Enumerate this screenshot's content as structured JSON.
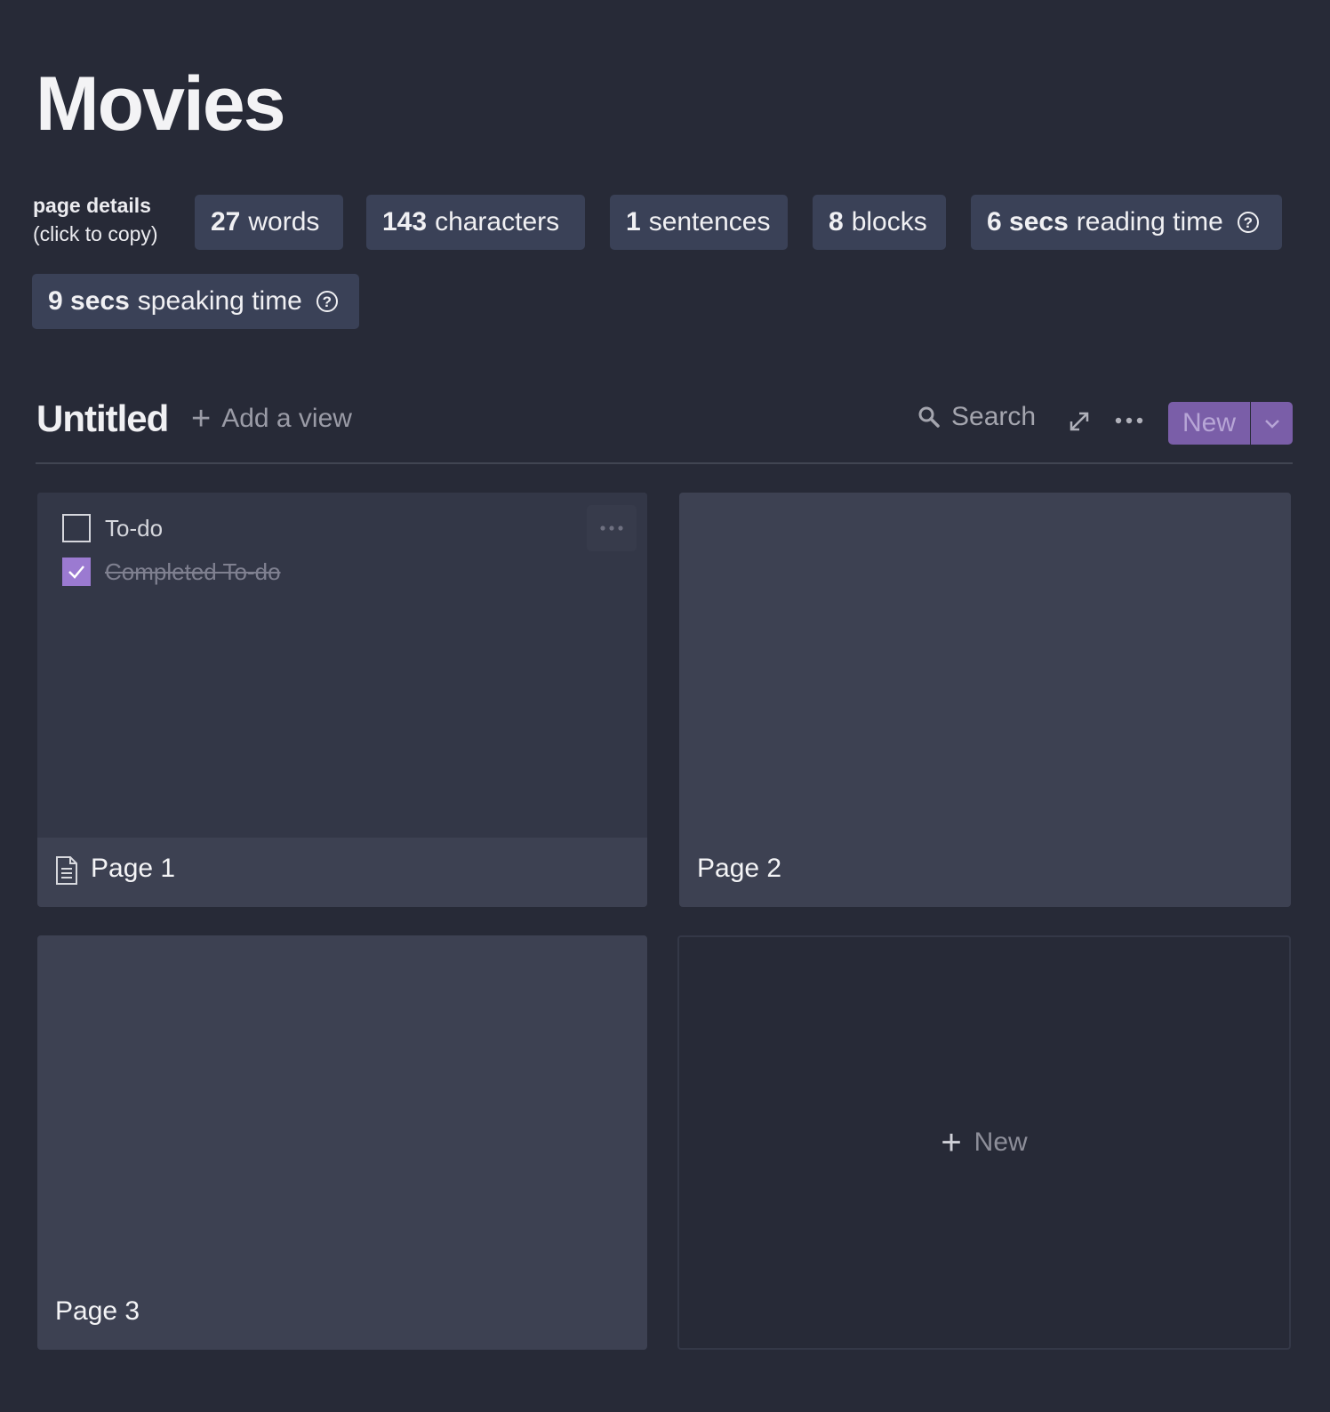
{
  "page": {
    "title": "Movies"
  },
  "details": {
    "label_line1": "page details",
    "label_line2": "(click to copy)",
    "words": {
      "value": "27",
      "unit": "words"
    },
    "characters": {
      "value": "143",
      "unit": "characters"
    },
    "sentences": {
      "value": "1",
      "unit": "sentences"
    },
    "blocks": {
      "value": "8",
      "unit": "blocks"
    },
    "reading": {
      "value": "6 secs",
      "unit": "reading time"
    },
    "speaking": {
      "value": "9 secs",
      "unit": "speaking time"
    },
    "help_glyph": "?"
  },
  "database": {
    "view_title": "Untitled",
    "add_view_label": "Add a view",
    "plus_glyph": "+",
    "search_label": "Search",
    "new_button_label": "New"
  },
  "cards": [
    {
      "title": "Page 1",
      "todos": [
        {
          "text": "To-do",
          "checked": false
        },
        {
          "text": "Completed To-do",
          "checked": true
        }
      ]
    },
    {
      "title": "Page 2"
    },
    {
      "title": "Page 3"
    }
  ],
  "new_card_label": "New",
  "colors": {
    "background": "#272a37",
    "chip": "#3a4157",
    "accent": "#7a5ea8",
    "checkbox_checked": "#9b7ad1"
  }
}
